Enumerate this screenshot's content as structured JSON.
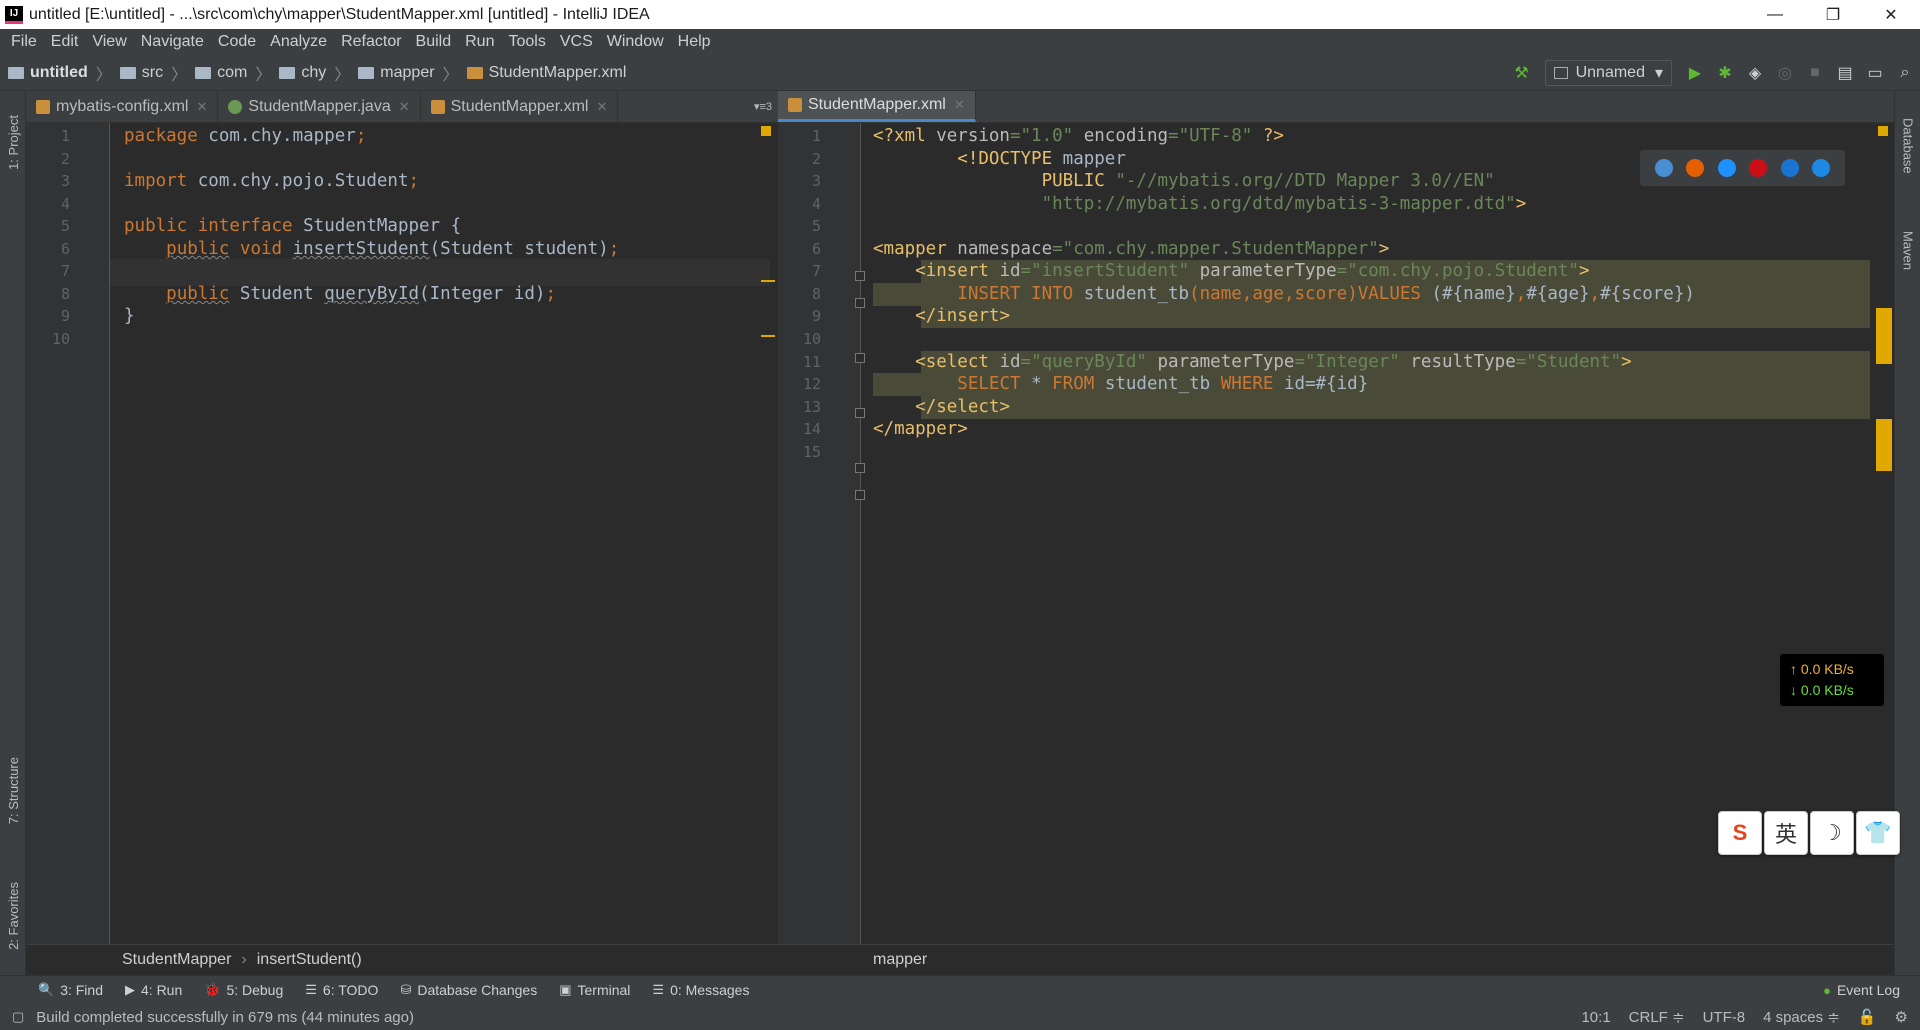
{
  "window": {
    "title": "untitled [E:\\untitled] - ...\\src\\com\\chy\\mapper\\StudentMapper.xml [untitled] - IntelliJ IDEA",
    "app_icon_label": "IJ",
    "minimize": "—",
    "restore": "❐",
    "close": "✕"
  },
  "menu": [
    "File",
    "Edit",
    "View",
    "Navigate",
    "Code",
    "Analyze",
    "Refactor",
    "Build",
    "Run",
    "Tools",
    "VCS",
    "Window",
    "Help"
  ],
  "breadcrumb": [
    "untitled",
    "src",
    "com",
    "chy",
    "mapper",
    "StudentMapper.xml"
  ],
  "run_config": "Unnamed",
  "left_tool_tabs": [
    "1: Project",
    "7: Structure",
    "2: Favorites"
  ],
  "right_tool_tabs": [
    "Database",
    "Maven"
  ],
  "left_tabs": [
    {
      "label": "mybatis-config.xml",
      "icon_color": "#c98f3a",
      "active": false
    },
    {
      "label": "StudentMapper.java",
      "icon_color": "#6a9955",
      "active": false
    },
    {
      "label": "StudentMapper.xml",
      "icon_color": "#c98f3a",
      "active": false
    }
  ],
  "left_tab_overflow": "▾≡3",
  "right_tabs": [
    {
      "label": "StudentMapper.xml",
      "icon_color": "#c98f3a",
      "active": true
    }
  ],
  "left_code": [
    {
      "n": "1",
      "parts": [
        [
          "kw",
          "package "
        ],
        [
          "pl",
          "com.chy.mapper"
        ],
        [
          "sq",
          ";"
        ]
      ]
    },
    {
      "n": "2",
      "parts": []
    },
    {
      "n": "3",
      "parts": [
        [
          "kw",
          "import "
        ],
        [
          "pl",
          "com.chy.pojo.Student"
        ],
        [
          "sq",
          ";"
        ]
      ]
    },
    {
      "n": "4",
      "parts": []
    },
    {
      "n": "5",
      "parts": [
        [
          "kw",
          "public interface "
        ],
        [
          "pl",
          "StudentMapper {"
        ]
      ]
    },
    {
      "n": "6",
      "parts": [
        [
          "pl",
          "    "
        ],
        [
          "kwu",
          "public"
        ],
        [
          "kw",
          " void "
        ],
        [
          "plu",
          "insertStudent"
        ],
        [
          "pl",
          "(Student student)"
        ],
        [
          "sq",
          ";"
        ]
      ]
    },
    {
      "n": "7",
      "parts": []
    },
    {
      "n": "8",
      "parts": [
        [
          "pl",
          "    "
        ],
        [
          "kwu",
          "public"
        ],
        [
          "pl",
          " Student "
        ],
        [
          "plu",
          "queryById"
        ],
        [
          "pl",
          "(Integer id)"
        ],
        [
          "sq",
          ";"
        ]
      ]
    },
    {
      "n": "9",
      "parts": [
        [
          "pl",
          "}"
        ]
      ]
    },
    {
      "n": "10",
      "parts": []
    }
  ],
  "right_code": [
    {
      "n": "1",
      "parts": [
        [
          "tg",
          "<?xml "
        ],
        [
          "an",
          "version"
        ],
        [
          "st",
          "=\"1.0\""
        ],
        [
          "an",
          " encoding"
        ],
        [
          "st",
          "=\"UTF-8\""
        ],
        [
          "tg",
          " ?>"
        ]
      ]
    },
    {
      "n": "2",
      "parts": [
        [
          "pl",
          "        "
        ],
        [
          "tg",
          "<!DOCTYPE "
        ],
        [
          "pl",
          "mapper"
        ]
      ]
    },
    {
      "n": "3",
      "parts": [
        [
          "pl",
          "                "
        ],
        [
          "tg",
          "PUBLIC "
        ],
        [
          "st",
          "\"-//mybatis.org//DTD Mapper 3.0//EN\""
        ]
      ]
    },
    {
      "n": "4",
      "parts": [
        [
          "pl",
          "                "
        ],
        [
          "st",
          "\"http://mybatis.org/dtd/mybatis-3-mapper.dtd\""
        ],
        [
          "tg",
          ">"
        ]
      ]
    },
    {
      "n": "5",
      "parts": []
    },
    {
      "n": "6",
      "parts": [
        [
          "tg",
          "<mapper "
        ],
        [
          "an",
          "namespace"
        ],
        [
          "st",
          "=\"com.chy.mapper.StudentMapper\""
        ],
        [
          "tg",
          ">"
        ]
      ]
    },
    {
      "n": "7",
      "parts": [
        [
          "pl",
          "    "
        ],
        [
          "tg",
          "<insert "
        ],
        [
          "an",
          "id"
        ],
        [
          "st",
          "=\"insertStudent\""
        ],
        [
          "an",
          " parameterType"
        ],
        [
          "st",
          "=\"com.chy.pojo.Student\""
        ],
        [
          "tg",
          ">"
        ]
      ]
    },
    {
      "n": "8",
      "parts": [
        [
          "pl",
          "        "
        ],
        [
          "kw",
          "INSERT INTO "
        ],
        [
          "pl",
          "student_tb"
        ],
        [
          "kw",
          "("
        ],
        [
          "sq",
          "name"
        ],
        [
          "kw",
          ","
        ],
        [
          "sq",
          "age"
        ],
        [
          "kw",
          ","
        ],
        [
          "sq",
          "score"
        ],
        [
          "kw",
          ")VALUES "
        ],
        [
          "pl",
          "(#{name}"
        ],
        [
          "kw",
          ","
        ],
        [
          "pl",
          "#{age}"
        ],
        [
          "kw",
          ","
        ],
        [
          "pl",
          "#{score})"
        ]
      ]
    },
    {
      "n": "9",
      "parts": [
        [
          "pl",
          "    "
        ],
        [
          "tg",
          "</insert>"
        ]
      ]
    },
    {
      "n": "10",
      "parts": []
    },
    {
      "n": "11",
      "parts": [
        [
          "pl",
          "    "
        ],
        [
          "tg",
          "<select "
        ],
        [
          "an",
          "id"
        ],
        [
          "st",
          "=\"queryById\""
        ],
        [
          "an",
          " parameterType"
        ],
        [
          "st",
          "=\"Integer\""
        ],
        [
          "an",
          " resultType"
        ],
        [
          "st",
          "=\"Student\""
        ],
        [
          "tg",
          ">"
        ]
      ]
    },
    {
      "n": "12",
      "parts": [
        [
          "pl",
          "        "
        ],
        [
          "kw",
          "SELECT "
        ],
        [
          "pl",
          "* "
        ],
        [
          "kw",
          "FROM "
        ],
        [
          "pl",
          "student_tb "
        ],
        [
          "kw",
          "WHERE "
        ],
        [
          "pl",
          "id=#{id}"
        ]
      ]
    },
    {
      "n": "13",
      "parts": [
        [
          "pl",
          "    "
        ],
        [
          "tg",
          "</select>"
        ]
      ]
    },
    {
      "n": "14",
      "parts": [
        [
          "tg",
          "</mapper>"
        ]
      ]
    },
    {
      "n": "15",
      "parts": []
    }
  ],
  "left_breadcrumb": [
    "StudentMapper",
    "insertStudent()"
  ],
  "right_breadcrumb": [
    "mapper"
  ],
  "tool_windows": [
    {
      "icon": "🔍",
      "label": "3: Find"
    },
    {
      "icon": "▶",
      "label": "4: Run"
    },
    {
      "icon": "🐞",
      "label": "5: Debug"
    },
    {
      "icon": "☰",
      "label": "6: TODO"
    },
    {
      "icon": "⛁",
      "label": "Database Changes"
    },
    {
      "icon": "▣",
      "label": "Terminal"
    },
    {
      "icon": "☰",
      "label": "0: Messages"
    }
  ],
  "event_log": "Event Log",
  "status": {
    "message": "Build completed successfully in 679 ms (44 minutes ago)",
    "position": "10:1",
    "line_sep": "CRLF ≑",
    "encoding": "UTF-8",
    "indent": "4 spaces ≑"
  },
  "net": {
    "up": "↑ 0.0 KB/s",
    "down": "↓ 0.0 KB/s"
  },
  "ime": [
    "S",
    "英",
    "☽",
    "👕"
  ],
  "browser_colors": [
    "#4a8fd4",
    "#e66000",
    "#1e90ff",
    "#cc0f16",
    "#1a75d1",
    "#1e88e5"
  ]
}
